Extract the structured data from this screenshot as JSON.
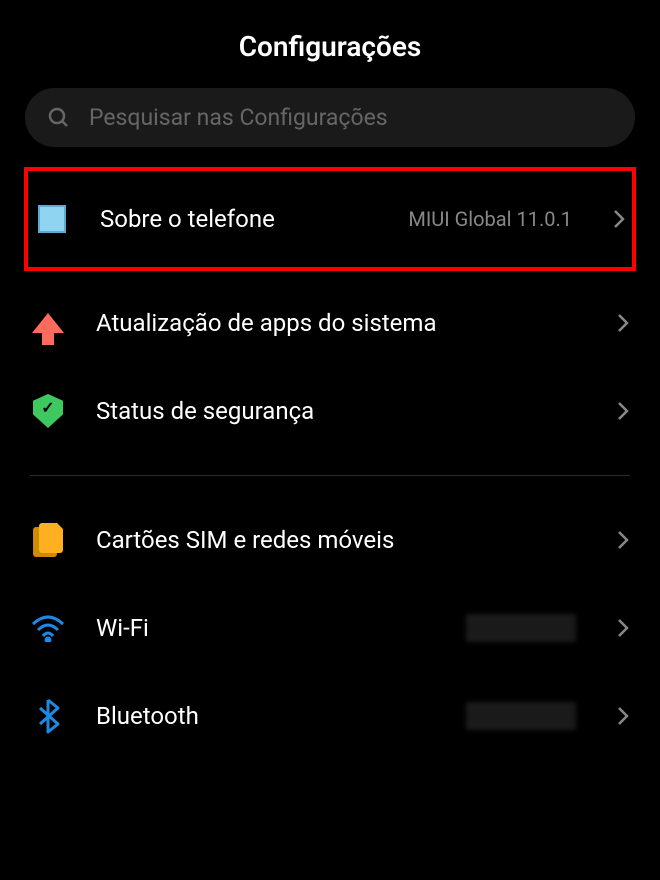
{
  "header": {
    "title": "Configurações"
  },
  "search": {
    "placeholder": "Pesquisar nas Configurações"
  },
  "items": [
    {
      "icon": "square-icon",
      "label": "Sobre o telefone",
      "value": "MIUI Global 11.0.1",
      "highlighted": true
    },
    {
      "icon": "arrow-up-icon",
      "label": "Atualização de apps do sistema",
      "value": ""
    },
    {
      "icon": "shield-check-icon",
      "label": "Status de segurança",
      "value": ""
    }
  ],
  "items2": [
    {
      "icon": "sim-icon",
      "label": "Cartões SIM e redes móveis",
      "value": ""
    },
    {
      "icon": "wifi-icon",
      "label": "Wi-Fi",
      "value": "redacted"
    },
    {
      "icon": "bluetooth-icon",
      "label": "Bluetooth",
      "value": "redacted"
    }
  ],
  "colors": {
    "accent_blue": "#1e88e5",
    "highlight_red": "#ff0000",
    "icon_cyan": "#8fd4f0",
    "icon_coral": "#ff6b5b",
    "icon_green": "#3dc960",
    "icon_orange": "#ffb020"
  }
}
